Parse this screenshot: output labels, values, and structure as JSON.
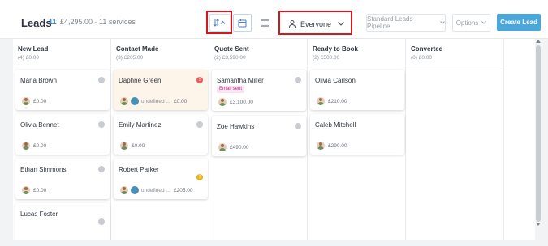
{
  "header": {
    "title": "Leads",
    "count": "11",
    "summary": "£4,295.00 · 11 services",
    "everyone_label": "Everyone",
    "pipeline_label": "Standard Leads Pipeline",
    "options_label": "Options",
    "create_label": "Create Lead"
  },
  "columns": [
    {
      "name": "New Lead",
      "stat": "(4) £0.00",
      "cards": [
        {
          "name": "Maria Brown",
          "amount": "£0.00"
        },
        {
          "name": "Olivia Bennet",
          "amount": "£0.00"
        },
        {
          "name": "Ethan Simmons",
          "amount": "£0.00"
        },
        {
          "name": "Lucas Foster"
        }
      ]
    },
    {
      "name": "Contact Made",
      "stat": "(3) £205.00",
      "cards": [
        {
          "name": "Daphne Green",
          "undefined": "undefined ...",
          "amount": "£0.00",
          "badge": "!"
        },
        {
          "name": "Emily Martinez",
          "amount": "£0.00"
        },
        {
          "name": "Robert Parker",
          "undefined": "undefined ...",
          "amount": "£205.00",
          "badge": "!"
        }
      ]
    },
    {
      "name": "Quote Sent",
      "stat": "(2) £3,590.00",
      "cards": [
        {
          "name": "Samantha Miller",
          "tag": "Email sent",
          "amount": "£3,100.00"
        },
        {
          "name": "Zoe Hawkins",
          "amount": "£490.00"
        }
      ]
    },
    {
      "name": "Ready to Book",
      "stat": "(2) £500.00",
      "cards": [
        {
          "name": "Olivia Carlson",
          "amount": "£210.00"
        },
        {
          "name": "Caleb Mitchell",
          "amount": "£290.00"
        }
      ]
    },
    {
      "name": "Converted",
      "stat": "(0) £0.00",
      "cards": []
    }
  ],
  "colors": {
    "accent": "#4ba6d9",
    "highlight": "#d9161c",
    "card_highlight": "#fdf4ea"
  }
}
